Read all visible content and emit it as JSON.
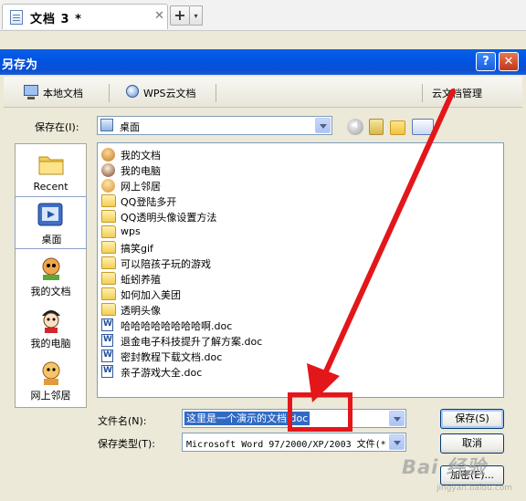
{
  "tab": {
    "title": "文档 3 *",
    "close": "✕",
    "new_label": "+",
    "new_arrow": "▾"
  },
  "dialog": {
    "title": "另存为",
    "help": "?",
    "close": "✕",
    "tabs": {
      "local": "本地文档",
      "wps": "WPS云文档",
      "cloud": "云文档管理"
    },
    "save_in_label": "保存在(I):",
    "save_in_value": "桌面",
    "places": [
      {
        "label": "Recent",
        "icon": "recent-folder-icon"
      },
      {
        "label": "桌面",
        "icon": "desktop-icon"
      },
      {
        "label": "我的文档",
        "icon": "my-documents-icon"
      },
      {
        "label": "我的电脑",
        "icon": "my-computer-icon"
      },
      {
        "label": "网上邻居",
        "icon": "network-places-icon"
      }
    ],
    "files": [
      {
        "name": "我的文档",
        "icon": "mydocs"
      },
      {
        "name": "我的电脑",
        "icon": "mypc"
      },
      {
        "name": "网上邻居",
        "icon": "network"
      },
      {
        "name": "QQ登陆多开",
        "icon": "folder"
      },
      {
        "name": "QQ透明头像设置方法",
        "icon": "folder"
      },
      {
        "name": "wps",
        "icon": "folder"
      },
      {
        "name": "搞笑gif",
        "icon": "folder"
      },
      {
        "name": "可以陪孩子玩的游戏",
        "icon": "folder"
      },
      {
        "name": "蚯蚓养殖",
        "icon": "folder"
      },
      {
        "name": "如何加入美团",
        "icon": "folder"
      },
      {
        "name": "透明头像",
        "icon": "folder"
      },
      {
        "name": "哈哈哈哈哈哈哈哈啊.doc",
        "icon": "doc"
      },
      {
        "name": "退金电子科技提升了解方案.doc",
        "icon": "doc"
      },
      {
        "name": "密封教程下载文档.doc",
        "icon": "doc"
      },
      {
        "name": "亲子游戏大全.doc",
        "icon": "doc"
      }
    ],
    "filename_label": "文件名(N):",
    "filename_value": "这里是一个演示的文档.doc",
    "filetype_label": "保存类型(T):",
    "filetype_value": "Microsoft Word 97/2000/XP/2003 文件(*",
    "save_button": "保存(S)",
    "cancel_button": "取消",
    "encrypt_button": "加密(E)..."
  },
  "annotation": {
    "color": "#e3161a"
  },
  "watermark": {
    "main": "Bai 经验",
    "sub": "jingyan.baidu.com"
  }
}
